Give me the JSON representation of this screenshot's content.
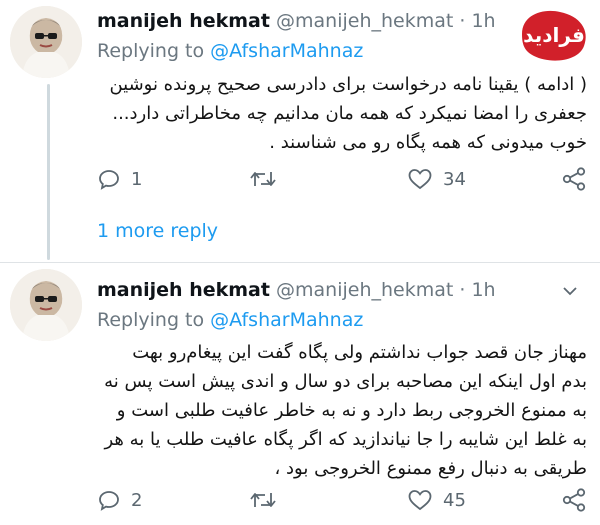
{
  "tweets": [
    {
      "name": "manijeh hekmat",
      "handle": "@manijeh_hekmat",
      "separator": "·",
      "time": "1h",
      "replying_prefix": "Replying to",
      "replying_to": "@AfsharMahnaz",
      "body_lines": [
        "( ادامه ) یقینا نامه درخواست برای دادرسی صحیح پرونده نوشین",
        "جعفری را امضا نمیکرد که همه مان مدانیم چه مخاطراتی دارد...",
        "خوب میدونی که همه پگاه رو می شناسند ."
      ],
      "reply_count": "1",
      "retweet_count": "",
      "like_count": "34"
    },
    {
      "name": "manijeh hekmat",
      "handle": "@manijeh_hekmat",
      "separator": "·",
      "time": "1h",
      "replying_prefix": "Replying to",
      "replying_to": "@AfsharMahnaz",
      "body_lines": [
        "مهناز جان قصد جواب نداشتم ولی پگاه گفت این پیغام‌رو بهت",
        "بدم اول اینکه این مصاحبه برای دو سال و اندی پیش است پس نه",
        "به ممنوع الخروجی ربط دارد و نه به خاطر عافیت طلبی است و",
        "به غلط این شایبه را جا نیاندازید که اگر پگاه عافیت طلب یا به هر",
        "طریقی به دنبال رفع ممنوع الخروجی بود ،"
      ],
      "reply_count": "2",
      "retweet_count": "",
      "like_count": "45"
    }
  ],
  "thread": {
    "more_reply_label": "1 more reply"
  },
  "watermark": {
    "text": "فرادید",
    "color": "#d1202a"
  },
  "icons": [
    "reply-icon",
    "retweet-icon",
    "like-icon",
    "share-icon",
    "chevron-down-icon"
  ],
  "colors": {
    "link": "#1d9bf0",
    "muted": "#6b7780",
    "icon": "#5b6770",
    "divider": "#dfe3e6"
  }
}
